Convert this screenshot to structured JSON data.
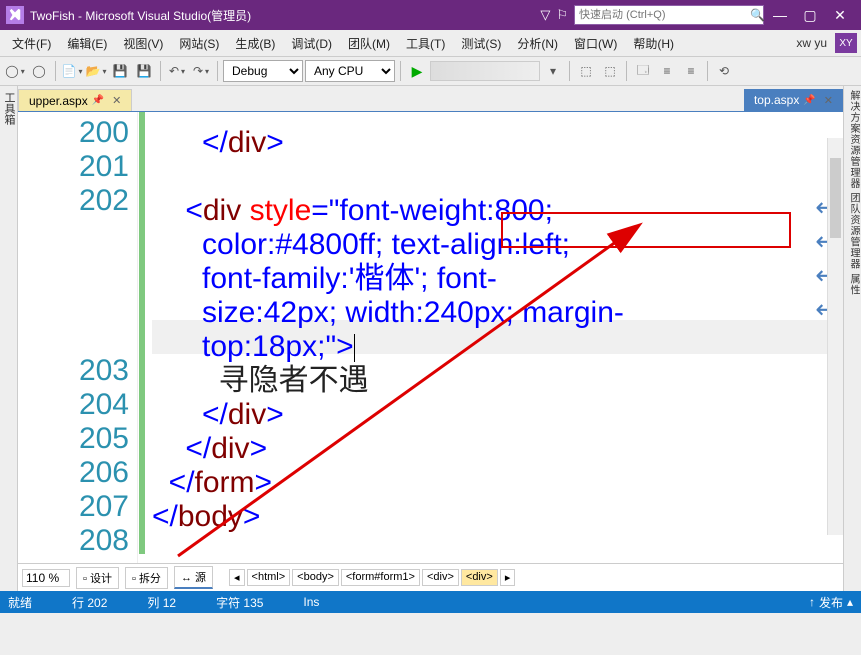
{
  "title": "TwoFish - Microsoft Visual Studio(管理员)",
  "quicklaunch_placeholder": "快速启动 (Ctrl+Q)",
  "menus": [
    "文件(F)",
    "编辑(E)",
    "视图(V)",
    "网站(S)",
    "生成(B)",
    "调试(D)",
    "团队(M)",
    "工具(T)",
    "测试(S)",
    "分析(N)",
    "窗口(W)",
    "帮助(H)"
  ],
  "username": "xw yu",
  "userbadge": "XY",
  "toolbar": {
    "config": "Debug",
    "platform": "Any CPU"
  },
  "left_tool": "工具箱",
  "right_tools": "解决方案资源管理器  团队资源管理器  属性",
  "tabs": {
    "active": "upper.aspx",
    "inactive": "top.aspx"
  },
  "gutter": [
    "200",
    "201",
    "202",
    "",
    "",
    "",
    "",
    "203",
    "204",
    "205",
    "206",
    "207",
    "208"
  ],
  "code": {
    "l200": "        </div>",
    "l201": "",
    "l202a": "        <div style=\"font-weight:800;",
    "l202b": "          color:#4800ff; text-align:left;",
    "l202c": "          font-family:'楷体'; font-",
    "l202d": "          size:42px; width:240px; margin-",
    "l202e": "          top:18px;\">",
    "l203": "            寻隐者不遇",
    "l204": "        </div>",
    "l205": "      </div>",
    "l206": "    </form>",
    "l207": "</body>",
    "l208": ""
  },
  "zoom": "110 %",
  "viewtabs": {
    "design": "设计",
    "split": "拆分",
    "source": "源"
  },
  "breadcrumbs": [
    "<html>",
    "<body>",
    "<form#form1>",
    "<div>",
    "<div>"
  ],
  "status": {
    "ready": "就绪",
    "line": "行 202",
    "col": "列 12",
    "char": "字符 135",
    "ins": "Ins",
    "publish": "发布"
  }
}
